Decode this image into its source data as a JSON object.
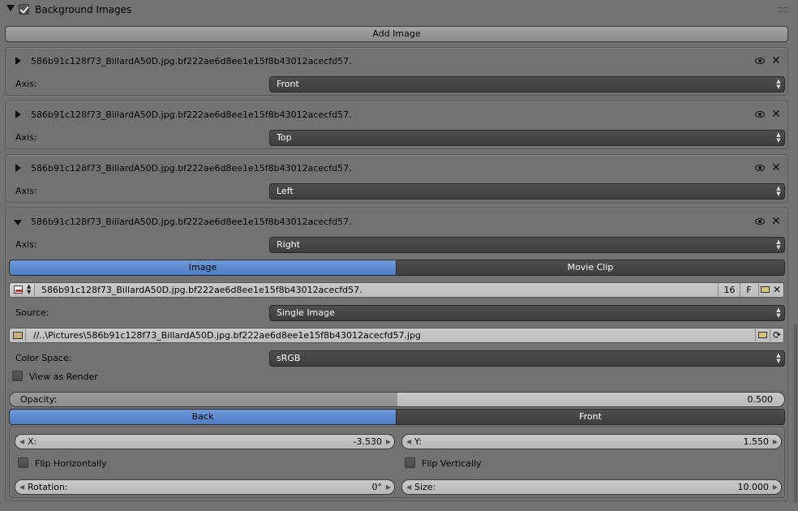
{
  "panel": {
    "title": "Background Images",
    "enabled": true
  },
  "add_image_label": "Add Image",
  "images": [
    {
      "name": "586b91c128f73_BillardA50D.jpg.bf222ae6d8ee1e15f8b43012acecfd57.",
      "axis_label": "Axis:",
      "axis": "Front",
      "expanded": false
    },
    {
      "name": "586b91c128f73_BillardA50D.jpg.bf222ae6d8ee1e15f8b43012acecfd57.",
      "axis_label": "Axis:",
      "axis": "Top",
      "expanded": false
    },
    {
      "name": "586b91c128f73_BillardA50D.jpg.bf222ae6d8ee1e15f8b43012acecfd57.",
      "axis_label": "Axis:",
      "axis": "Left",
      "expanded": false
    },
    {
      "name": "586b91c128f73_BillardA50D.jpg.bf222ae6d8ee1e15f8b43012acecfd57.",
      "axis_label": "Axis:",
      "axis": "Right",
      "expanded": true
    }
  ],
  "expanded": {
    "source_type_tabs": [
      "Image",
      "Movie Clip"
    ],
    "active_source_type": "Image",
    "image_datablock": {
      "name": "586b91c128f73_BillardA50D.jpg.bf222ae6d8ee1e15f8b43012acecfd57.",
      "users": "16",
      "fake_user": "F"
    },
    "source_label": "Source:",
    "source": "Single Image",
    "filepath": "//..\\Pictures\\586b91c128f73_BillardA50D.jpg.bf222ae6d8ee1e15f8b43012acecfd57.jpg",
    "color_space_label": "Color Space:",
    "color_space": "sRGB",
    "view_as_render_label": "View as Render",
    "view_as_render": false,
    "opacity_label": "Opacity:",
    "opacity": "0.500",
    "opacity_fraction": 0.5,
    "draw_depth_tabs": [
      "Back",
      "Front"
    ],
    "active_draw_depth": "Back",
    "x_label": "X:",
    "x": "-3.530",
    "y_label": "Y:",
    "y": "1.550",
    "flip_h_label": "Flip Horizontally",
    "flip_v_label": "Flip Vertically",
    "rotation_label": "Rotation:",
    "rotation": "0°",
    "size_label": "Size:",
    "size": "10.000"
  },
  "colors": {
    "active_tab": "#5a8ad0",
    "panel_bg": "#727272",
    "dropdown_bg": "#444444"
  }
}
